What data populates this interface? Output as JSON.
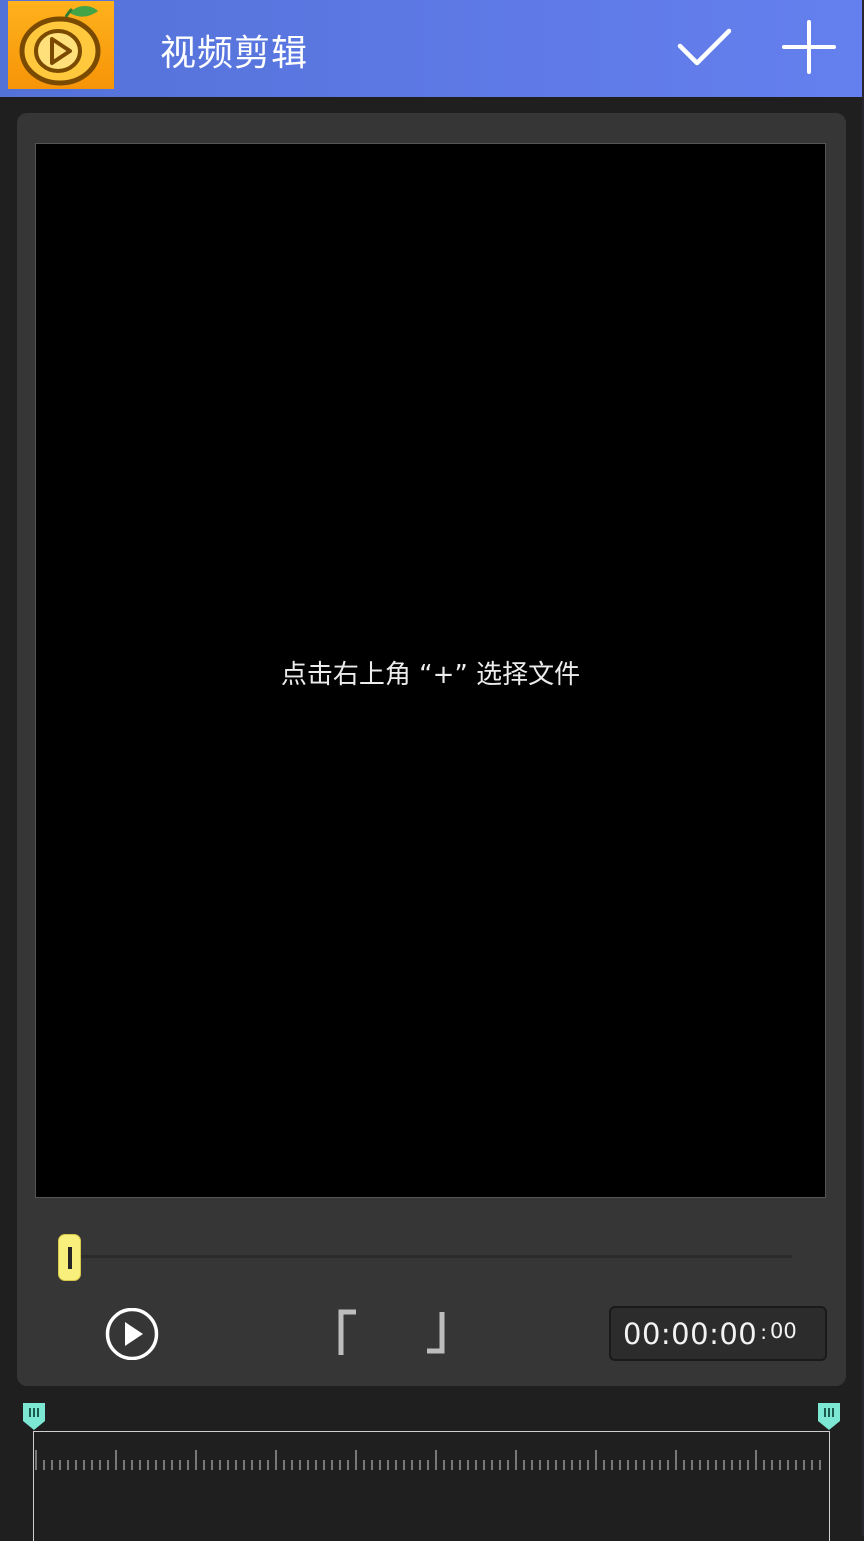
{
  "appbar": {
    "title": "视频剪辑",
    "logo_icon": "mango-play-logo-icon",
    "confirm_icon": "check-icon",
    "add_icon": "plus-icon",
    "background_color": "#5f7ae6"
  },
  "preview": {
    "hint": "点击右上角 “+” 选择文件"
  },
  "playback": {
    "progress": 0,
    "play_icon": "play-circle-icon",
    "mark_in_icon": "mark-in-bracket-icon",
    "mark_out_icon": "mark-out-bracket-icon",
    "time_main": "00:00:00",
    "time_frames": "00"
  },
  "timeline": {
    "handle_color": "#7ce8d4",
    "trim_start": 0,
    "trim_end": 1
  }
}
